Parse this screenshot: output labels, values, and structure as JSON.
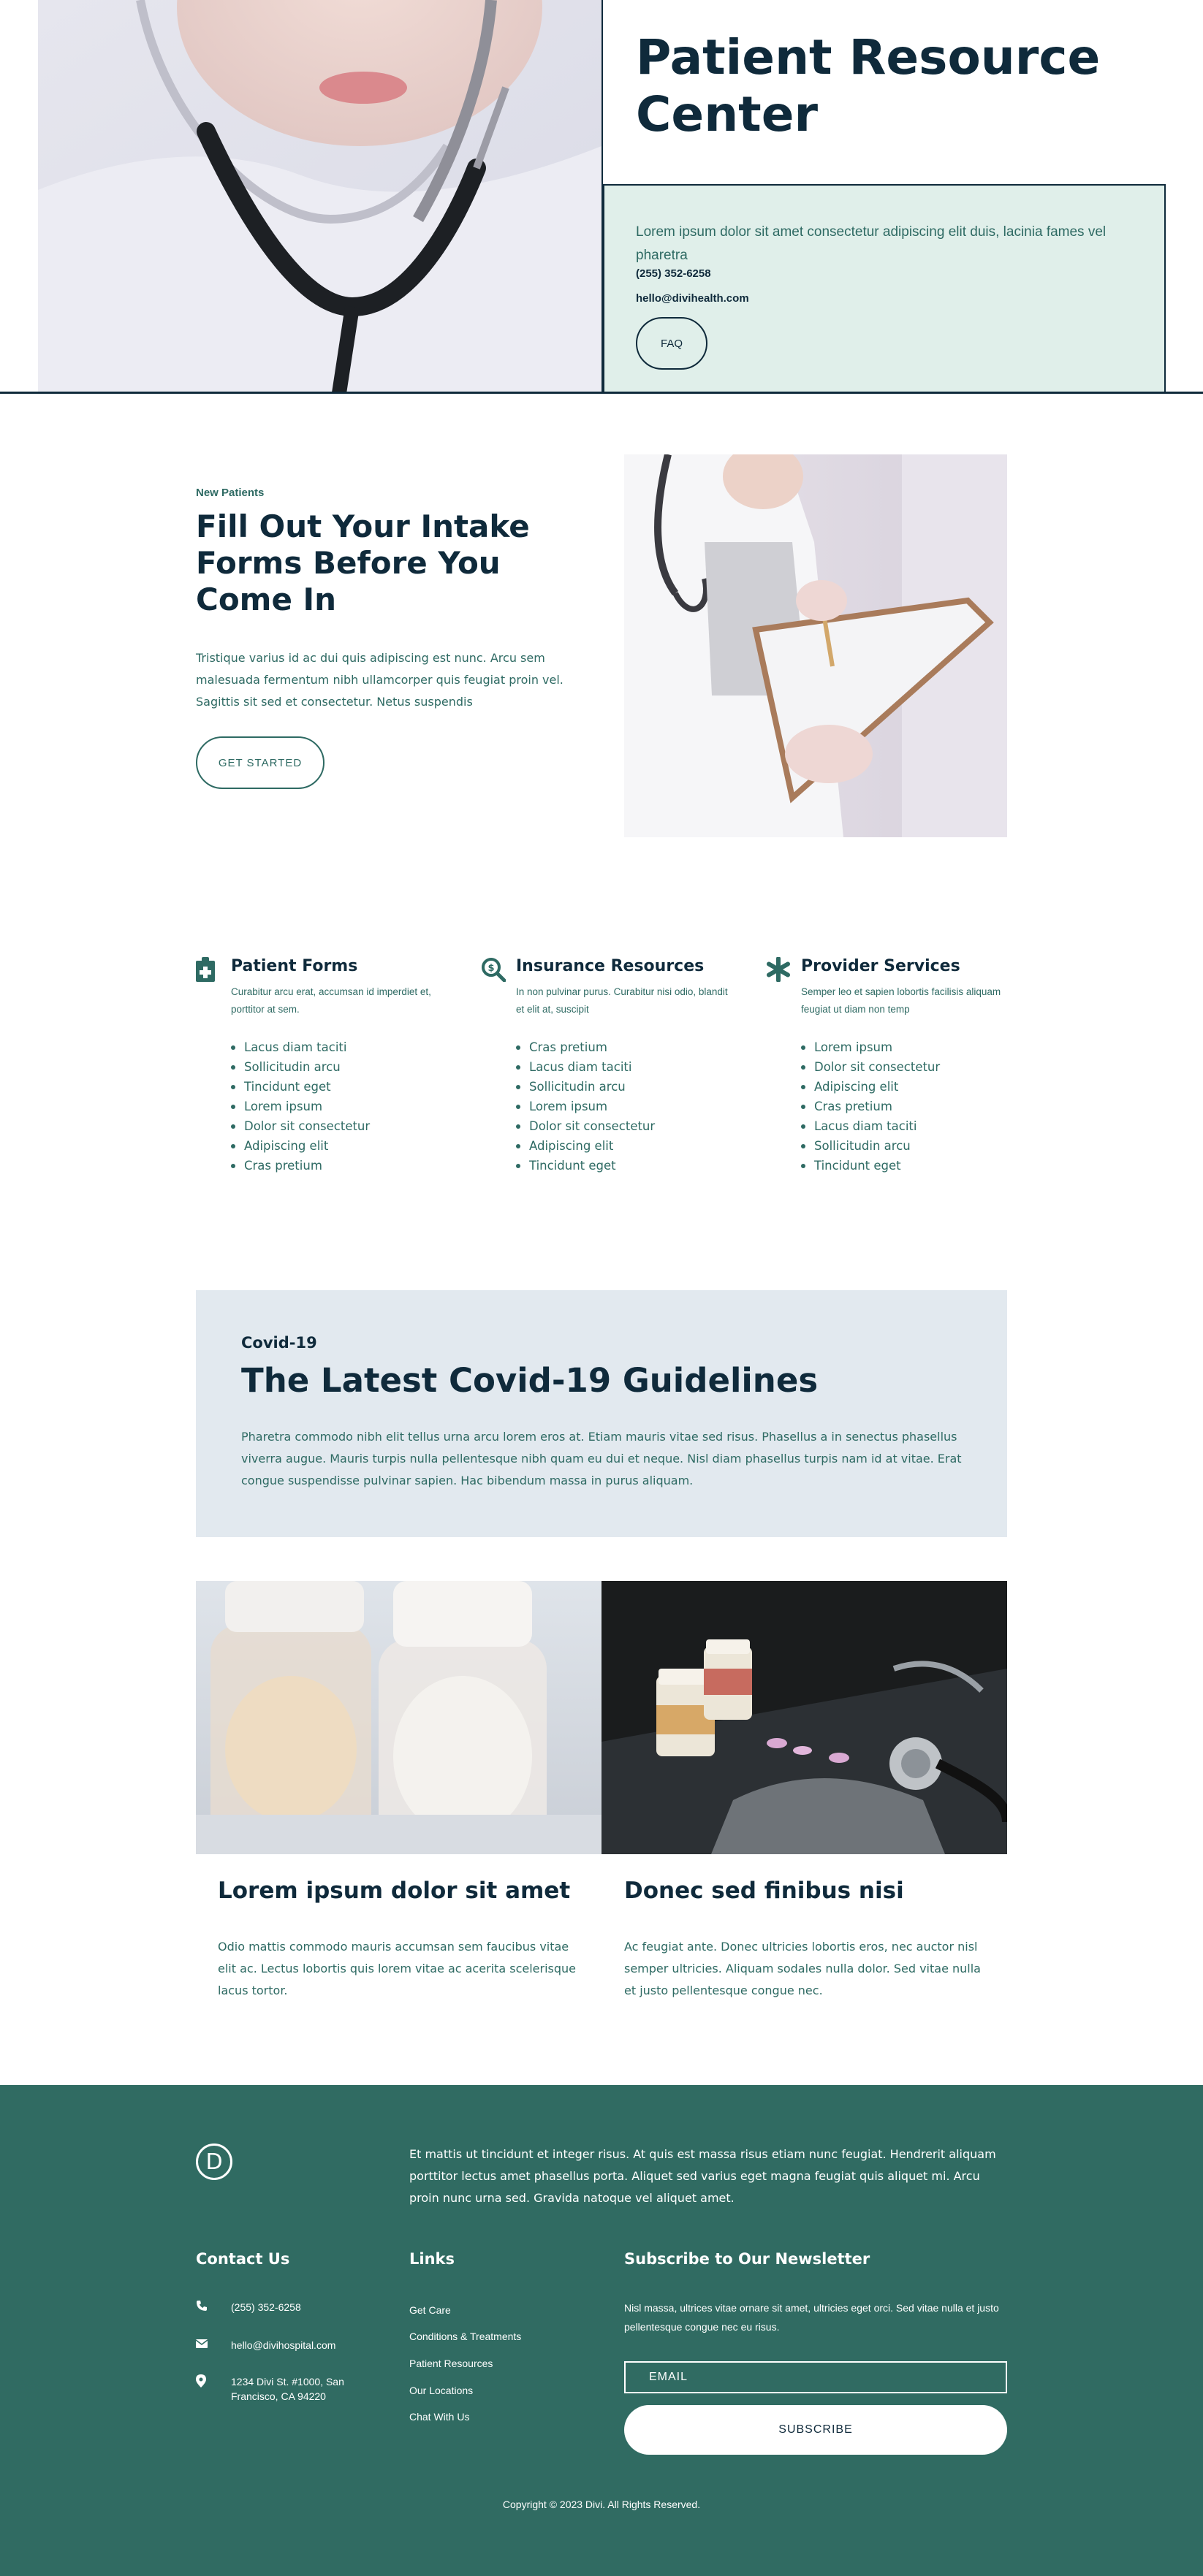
{
  "hero": {
    "title": "Patient Resource Center",
    "description": "Lorem ipsum dolor sit amet consectetur adipiscing elit duis, lacinia fames vel pharetra",
    "phone": "(255) 352-6258",
    "email": "hello@divihealth.com",
    "button_label": "FAQ"
  },
  "intake": {
    "label": "New Patients",
    "title": "Fill Out Your Intake Forms Before You Come In",
    "description": "Tristique varius id ac dui quis adipiscing est nunc. Arcu sem malesuada fermentum nibh ullamcorper quis feugiat proin vel. Sagittis sit sed et consectetur. Netus suspendis",
    "button_label": "GET STARTED"
  },
  "resources": [
    {
      "icon": "medical-kit-icon",
      "title": "Patient Forms",
      "description": "Curabitur arcu erat, accumsan id imperdiet et, porttitor at sem.",
      "items": [
        "Lacus diam taciti",
        "Sollicitudin arcu",
        "Tincidunt eget",
        "Lorem ipsum",
        "Dolor sit consectetur",
        "Adipiscing elit",
        "Cras pretium"
      ]
    },
    {
      "icon": "dollar-search-icon",
      "title": "Insurance Resources",
      "description": "In non pulvinar purus. Curabitur nisi odio, blandit et elit at, suscipit",
      "items": [
        "Cras pretium",
        "Lacus diam taciti",
        "Sollicitudin arcu",
        "Lorem ipsum",
        "Dolor sit consectetur",
        "Adipiscing elit",
        "Tincidunt eget"
      ]
    },
    {
      "icon": "asterisk-icon",
      "title": "Provider Services",
      "description": "Semper leo et sapien lobortis facilisis aliquam feugiat ut diam non temp",
      "items": [
        "Lorem ipsum",
        "Dolor sit consectetur",
        "Adipiscing elit",
        "Cras pretium",
        "Lacus diam taciti",
        "Sollicitudin arcu",
        "Tincidunt eget"
      ]
    }
  ],
  "covid": {
    "label": "Covid-19",
    "title": "The Latest Covid-19 Guidelines",
    "description": "Pharetra commodo nibh elit tellus urna arcu lorem eros at. Etiam mauris vitae sed risus. Phasellus a in senectus phasellus viverra augue. Mauris turpis nulla pellentesque nibh quam eu dui et neque. Nisl diam phasellus turpis nam id at vitae. Erat congue suspendisse pulvinar sapien. Hac bibendum massa in purus aliquam."
  },
  "articles": [
    {
      "title": "Lorem ipsum dolor sit amet",
      "description": "Odio mattis commodo mauris accumsan sem faucibus vitae elit ac. Lectus lobortis quis lorem vitae ac acerita scelerisque lacus tortor."
    },
    {
      "title": "Donec sed finibus nisi",
      "description": "Ac feugiat ante. Donec ultricies lobortis eros, nec auctor nisl semper ultricies. Aliquam sodales nulla dolor. Sed vitae nulla et justo pellentesque congue nec."
    }
  ],
  "footer": {
    "logo_letter": "D",
    "about": "Et mattis ut tincidunt et integer risus. At quis est massa risus etiam nunc feugiat. Hendrerit aliquam porttitor lectus amet phasellus porta. Aliquet sed varius eget magna feugiat quis aliquet mi. Arcu proin nunc urna sed. Gravida natoque vel aliquet amet.",
    "contact": {
      "heading": "Contact Us",
      "phone": "(255) 352-6258",
      "email": "hello@divihospital.com",
      "address": "1234 Divi St. #1000, San Francisco, CA 94220"
    },
    "links": {
      "heading": "Links",
      "items": [
        "Get Care",
        "Conditions & Treatments",
        "Patient Resources",
        "Our Locations",
        "Chat With Us"
      ]
    },
    "newsletter": {
      "heading": "Subscribe to Our Newsletter",
      "description": "Nisl massa, ultrices vitae ornare sit amet, ultricies eget orci. Sed vitae nulla et justo pellentesque congue nec eu risus.",
      "email_placeholder": "EMAIL",
      "button_label": "SUBSCRIBE"
    },
    "copyright": "Copyright © 2023 Divi. All Rights Reserved."
  },
  "colors": {
    "dark_navy": "#0f2a3b",
    "teal": "#2e6a63",
    "footer_green": "#306b62",
    "mint": "#e0efea",
    "covid_bg": "#e2e9ef"
  }
}
